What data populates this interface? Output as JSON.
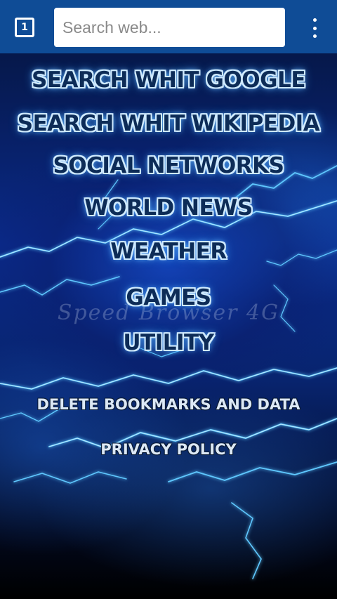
{
  "toolbar": {
    "tab_count": "1",
    "search_placeholder": "Search web...",
    "overflow_icon": "more-vert-icon"
  },
  "menu": {
    "items": [
      {
        "label": "SEARCH WHIT GOOGLE"
      },
      {
        "label": "SEARCH WHIT WIKIPEDIA"
      },
      {
        "label": "SOCIAL NETWORKS"
      },
      {
        "label": "WORLD NEWS"
      },
      {
        "label": "WEATHER"
      },
      {
        "label": "GAMES"
      },
      {
        "label": "UTILITY"
      }
    ],
    "delete_label": "DELETE BOOKMARKS AND DATA",
    "privacy_label": "PRIVACY POLICY"
  },
  "watermark": "Speed Browser 4G",
  "colors": {
    "toolbar": "#0f4c96",
    "button_text": "#0d2c57",
    "button_glow": "#cfeaff",
    "lightning": "#5fc8ff"
  }
}
